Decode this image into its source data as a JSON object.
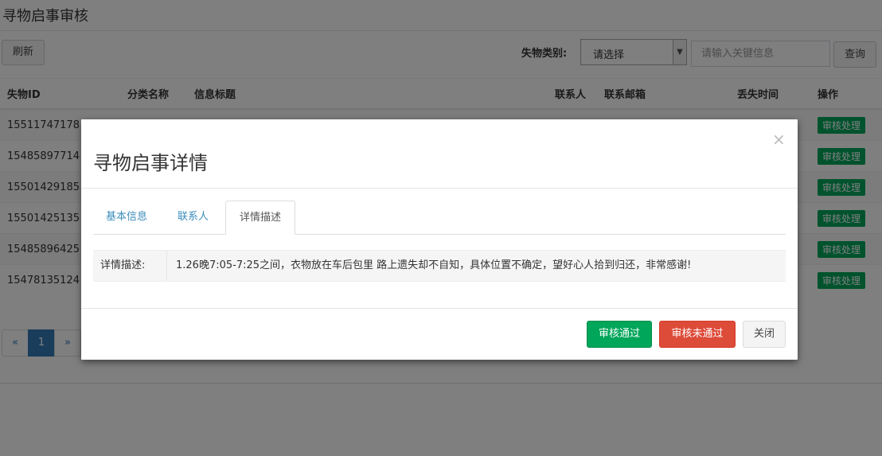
{
  "page": {
    "title": "寻物启事审核",
    "refresh_label": "刷新",
    "filter_label": "失物类别:",
    "category_select": {
      "value": "请选择",
      "arrow_icon": "chevron-down-icon"
    },
    "search_placeholder": "请输入关键信息",
    "query_label": "查询"
  },
  "table": {
    "headers": [
      "失物ID",
      "分类名称",
      "信息标题",
      "联系人",
      "联系邮箱",
      "丢失时间",
      "操作"
    ],
    "rows": [
      {
        "id": "15511747178",
        "action": "审核处理"
      },
      {
        "id": "15485897714",
        "action": "审核处理"
      },
      {
        "id": "15501429185",
        "action": "审核处理"
      },
      {
        "id": "15501425135",
        "action": "审核处理"
      },
      {
        "id": "15485896425",
        "action": "审核处理"
      },
      {
        "id": "15478135124",
        "action": "审核处理"
      }
    ]
  },
  "pagination": {
    "prev": "«",
    "current": "1",
    "next": "»"
  },
  "modal": {
    "title": "寻物启事详情",
    "close_symbol": "×",
    "tabs": [
      "基本信息",
      "联系人",
      "详情描述"
    ],
    "active_tab": "详情描述",
    "detail_label": "详情描述:",
    "detail_value": "1.26晚7:05-7:25之间，衣物放在车后包里 路上遗失却不自知，具体位置不确定，望好心人拾到归还，非常感谢!",
    "approve_label": "审核通过",
    "reject_label": "审核未通过",
    "close_label": "关闭"
  },
  "colors": {
    "success": "#00a65a",
    "danger": "#dd4b39",
    "primary": "#337ab7",
    "link": "#3c8dbc"
  }
}
